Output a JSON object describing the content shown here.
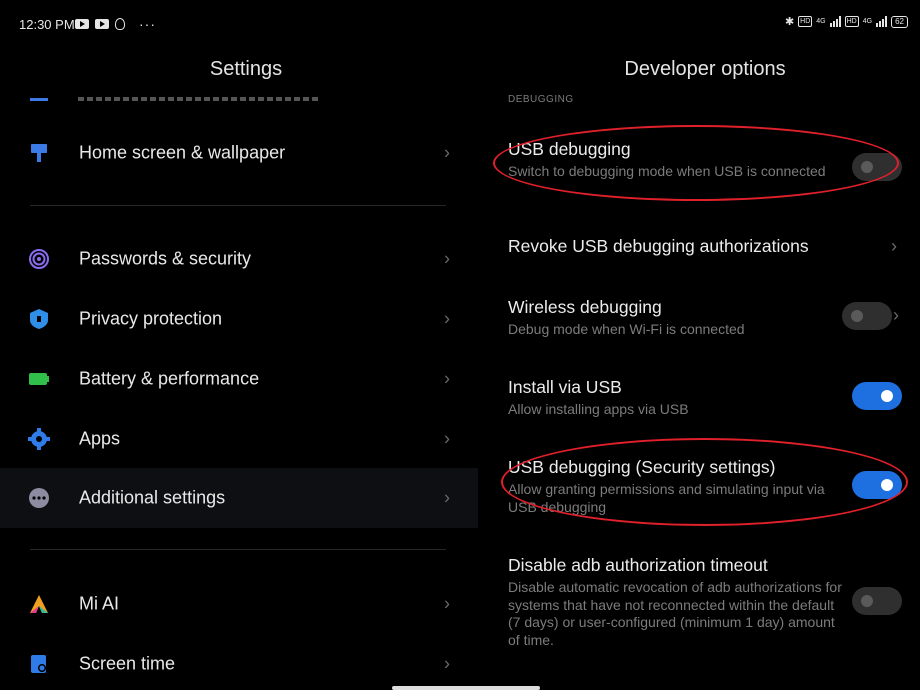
{
  "status_bar": {
    "time": "12:30 PM",
    "dots": "···",
    "battery": "62",
    "network_1": "4G",
    "network_2": "4G",
    "hd_1": "HD",
    "hd_2": "HD",
    "bluetooth": "✱"
  },
  "settings": {
    "title": "Settings",
    "items": [
      {
        "label": "Home screen & wallpaper",
        "icon": "paintbrush-icon",
        "color": "#3c7be6"
      },
      {
        "label": "Passwords & security",
        "icon": "fingerprint-icon",
        "color": "#8a6cf0"
      },
      {
        "label": "Privacy protection",
        "icon": "shield-icon",
        "color": "#2f8fe8"
      },
      {
        "label": "Battery & performance",
        "icon": "battery-icon",
        "color": "#2fbf4a"
      },
      {
        "label": "Apps",
        "icon": "gear-icon",
        "color": "#2f7be8"
      },
      {
        "label": "Additional settings",
        "icon": "more-dots-icon",
        "color": "#8c8ca0"
      },
      {
        "label": "Mi AI",
        "icon": "mi-ai-icon",
        "color": "#f0a020"
      },
      {
        "label": "Screen time",
        "icon": "hourglass-icon",
        "color": "#2f7be8"
      }
    ],
    "chevron": "›"
  },
  "developer": {
    "title": "Developer options",
    "section_label": "DEBUGGING",
    "options": [
      {
        "title": "USB debugging",
        "desc": "Switch to debugging mode when USB is connected",
        "toggle": "off"
      },
      {
        "title": "Revoke USB debugging authorizations",
        "desc": "",
        "toggle": "none"
      },
      {
        "title": "Wireless debugging",
        "desc": "Debug mode when Wi-Fi is connected",
        "toggle": "off"
      },
      {
        "title": "Install via USB",
        "desc": "Allow installing apps via USB",
        "toggle": "on"
      },
      {
        "title": "USB debugging (Security settings)",
        "desc": "Allow granting permissions and simulating input via USB debugging",
        "toggle": "on"
      },
      {
        "title": "Disable adb authorization timeout",
        "desc": "Disable automatic revocation of adb authorizations for systems that have not reconnected within the default (7 days) or user-configured (minimum 1 day) amount of time.",
        "toggle": "off"
      }
    ]
  },
  "colors": {
    "accent": "#1e6fe0",
    "annotation": "#e0202a"
  }
}
